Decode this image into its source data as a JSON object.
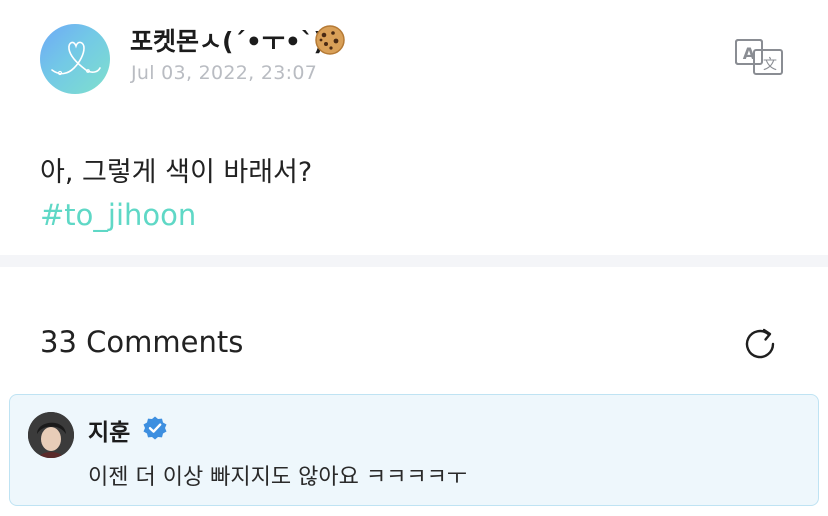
{
  "post": {
    "author_name": "포켓몬ㅅ(´•ㅜ•`)ა",
    "author_emoji_icon": "cookie-icon",
    "date": "Jul 03, 2022, 23:07",
    "text": "아, 그렇게 색이 바래서?",
    "hashtag": "#to_jihoon",
    "translate_icon": "translate-icon"
  },
  "comments": {
    "title": "33 Comments",
    "refresh_icon": "refresh-icon",
    "items": [
      {
        "author": "지훈",
        "verified_icon": "verified-badge-icon",
        "text": "이젠 더 이상 빠지지도 않아요 ㅋㅋㅋㅋㅜ"
      }
    ]
  },
  "colors": {
    "hashtag": "#5fd8c6",
    "date": "#b9bcc2",
    "comment_bg": "#eef7fc",
    "comment_border": "#bfe3f3",
    "verified": "#3d8fe0",
    "divider": "#f4f5f8"
  }
}
